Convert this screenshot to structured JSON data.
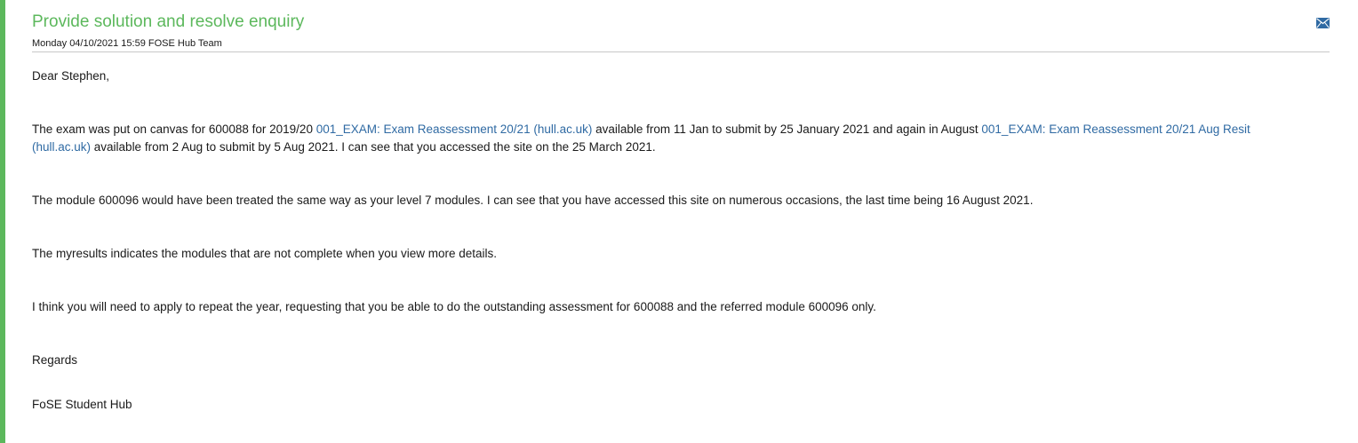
{
  "header": {
    "title": "Provide solution and resolve enquiry",
    "meta": "Monday 04/10/2021 15:59 FOSE Hub Team",
    "icon": "envelope-icon"
  },
  "message": {
    "greeting": "Dear Stephen,",
    "exam_paragraph": {
      "part1": "The exam was put on canvas for 600088 for 2019/20 ",
      "link1": "001_EXAM: Exam Reassessment 20/21 (hull.ac.uk)",
      "part2": " available from 11 Jan to submit by 25 January 2021 and again in August ",
      "link2": "001_EXAM: Exam Reassessment 20/21 Aug Resit (hull.ac.uk)",
      "part3": " available from  2 Aug to submit by 5 Aug 2021. I can see that you accessed the site on the 25 March 2021."
    },
    "module_paragraph": "The module 600096 would have been treated the same way as your level 7 modules. I can see that you have accessed this site on numerous occasions, the last time being 16 August 2021.",
    "results_paragraph": "The myresults indicates the modules that are not complete when you view more details.",
    "repeat_paragraph": "I think you will need to apply to repeat the year, requesting that you be able to do the outstanding assessment for 600088 and the referred module 600096 only.",
    "regards": "Regards",
    "signature": "FoSE Student Hub"
  },
  "colors": {
    "accent": "#5cb85c",
    "link": "#2f6aa3",
    "icon": "#2f6aa3"
  }
}
